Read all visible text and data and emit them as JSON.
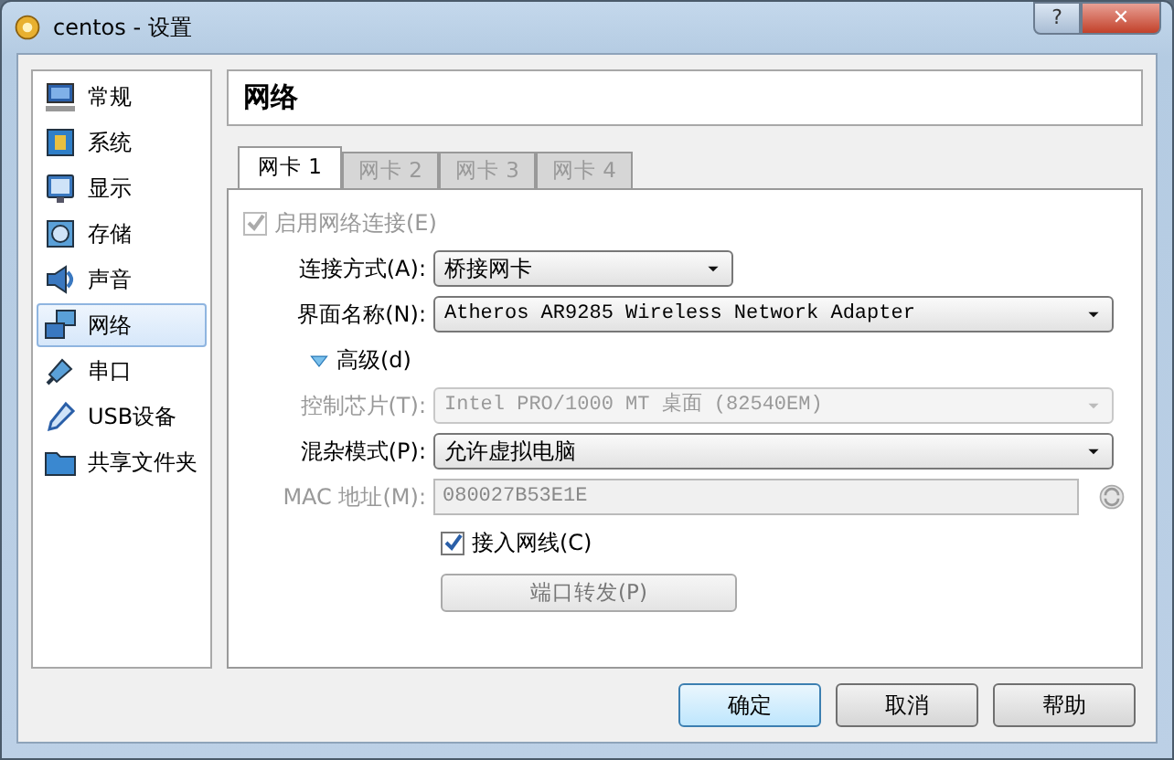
{
  "window": {
    "title": "centos - 设置",
    "help_button": "?",
    "close_button": "✕"
  },
  "sidebar": {
    "items": [
      {
        "label": "常规",
        "kind": "monitor",
        "selected": false
      },
      {
        "label": "系统",
        "kind": "chip",
        "selected": false
      },
      {
        "label": "显示",
        "kind": "display",
        "selected": false
      },
      {
        "label": "存储",
        "kind": "disk",
        "selected": false
      },
      {
        "label": "声音",
        "kind": "speaker",
        "selected": false
      },
      {
        "label": "网络",
        "kind": "network",
        "selected": true
      },
      {
        "label": "串口",
        "kind": "plug",
        "selected": false
      },
      {
        "label": "USB设备",
        "kind": "usb",
        "selected": false
      },
      {
        "label": "共享文件夹",
        "kind": "folder",
        "selected": false
      }
    ]
  },
  "page_title": "网络",
  "tabs": [
    {
      "label": "网卡 1",
      "selected": true
    },
    {
      "label": "网卡 2",
      "selected": false
    },
    {
      "label": "网卡 3",
      "selected": false
    },
    {
      "label": "网卡 4",
      "selected": false
    }
  ],
  "enable_checkbox": {
    "label": "启用网络连接(E)",
    "checked": true,
    "disabled": true
  },
  "attachment": {
    "kind": "short-select",
    "label": "连接方式(A):",
    "value": "桥接网卡",
    "disabled": false
  },
  "interface": {
    "kind": "select",
    "label": "界面名称(N):",
    "value": "Atheros AR9285 Wireless Network Adapter",
    "disabled": false
  },
  "advanced": {
    "label": "高级(d)",
    "expanded": true
  },
  "advanced_fields": [
    {
      "kind": "select",
      "label": "控制芯片(T):",
      "value": "Intel PRO/1000 MT 桌面 (82540EM)",
      "disabled": true
    },
    {
      "kind": "select",
      "label": "混杂模式(P):",
      "value": "允许虚拟电脑",
      "disabled": false
    },
    {
      "kind": "text",
      "label": "MAC 地址(M):",
      "value": "080027B53E1E",
      "disabled": true
    }
  ],
  "cable_checkbox": {
    "label": "接入网线(C)",
    "checked": true,
    "disabled": false
  },
  "port_forward_button": {
    "label": "端口转发(P)"
  },
  "buttons": [
    {
      "label": "确定",
      "default": true
    },
    {
      "label": "取消",
      "default": false
    },
    {
      "label": "帮助",
      "default": false
    }
  ]
}
